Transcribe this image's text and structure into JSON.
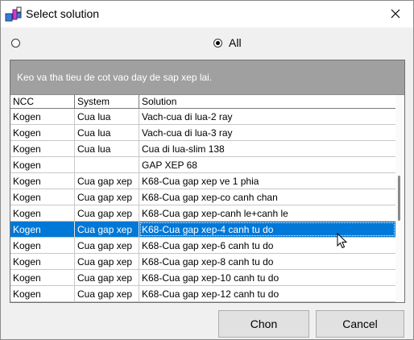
{
  "window": {
    "title": "Select solution",
    "icon": "app-icon",
    "close_icon": "close-icon"
  },
  "filter": {
    "option_left_label": "",
    "option_left_checked": false,
    "option_all_label": "All",
    "option_all_checked": true
  },
  "grid": {
    "group_panel_text": "Keo va tha tieu de cot vao day de sap xep lai.",
    "columns": [
      "NCC",
      "System",
      "Solution"
    ],
    "rows": [
      {
        "ncc": "Kogen",
        "system": "Cua lua",
        "solution": "Vach-cua di lua-2 ray"
      },
      {
        "ncc": "Kogen",
        "system": "Cua lua",
        "solution": "Vach-cua di lua-3 ray"
      },
      {
        "ncc": "Kogen",
        "system": "Cua lua",
        "solution": "Cua di lua-slim 138"
      },
      {
        "ncc": "Kogen",
        "system": "",
        "solution": "GAP XEP 68"
      },
      {
        "ncc": "Kogen",
        "system": "Cua gap xep",
        "solution": "K68-Cua gap xep ve 1 phia"
      },
      {
        "ncc": "Kogen",
        "system": "Cua gap xep",
        "solution": "K68-Cua gap xep-co canh chan"
      },
      {
        "ncc": "Kogen",
        "system": "Cua gap xep",
        "solution": "K68-Cua gap xep-canh le+canh le"
      },
      {
        "ncc": "Kogen",
        "system": "Cua gap xep",
        "solution": "K68-Cua gap xep-4 canh tu do"
      },
      {
        "ncc": "Kogen",
        "system": "Cua gap xep",
        "solution": "K68-Cua gap xep-6 canh tu do"
      },
      {
        "ncc": "Kogen",
        "system": "Cua gap xep",
        "solution": "K68-Cua gap xep-8 canh tu do"
      },
      {
        "ncc": "Kogen",
        "system": "Cua gap xep",
        "solution": "K68-Cua gap xep-10 canh tu do"
      },
      {
        "ncc": "Kogen",
        "system": "Cua gap xep",
        "solution": "K68-Cua gap xep-12 canh tu do"
      }
    ],
    "selected_row_index": 7
  },
  "buttons": {
    "ok_label": "Chon",
    "cancel_label": "Cancel"
  },
  "colors": {
    "selection": "#0078d7",
    "group_panel": "#a0a0a0",
    "dialog_bg": "#f0f0f0"
  }
}
